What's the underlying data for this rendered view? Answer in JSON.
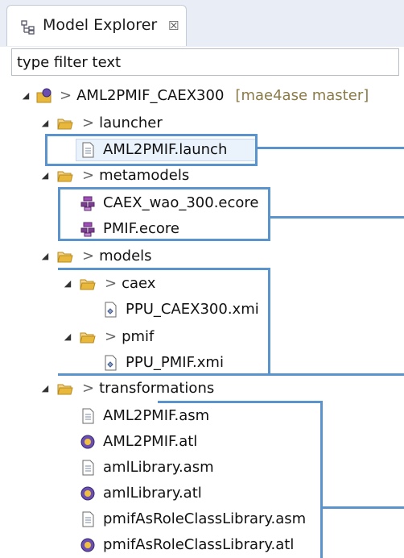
{
  "view": {
    "tab_title": "Model Explorer",
    "close_glyph": "☒",
    "tab_icon": "model-explorer-icon"
  },
  "filter": {
    "placeholder": "type filter text"
  },
  "tree": {
    "project": {
      "name": "AML2PMIF_CAEX300",
      "decoration": "[mae4ase master]",
      "prefix": ">"
    },
    "launcher": {
      "name": "launcher",
      "prefix": ">"
    },
    "launcher_file": "AML2PMIF.launch",
    "metamodels": {
      "name": "metamodels",
      "prefix": ">"
    },
    "metamodel_files": [
      "CAEX_wao_300.ecore",
      "PMIF.ecore"
    ],
    "models": {
      "name": "models",
      "prefix": ">"
    },
    "caex": {
      "name": "caex",
      "prefix": ">"
    },
    "caex_file": "PPU_CAEX300.xmi",
    "pmif": {
      "name": "pmif",
      "prefix": ">"
    },
    "pmif_file": "PPU_PMIF.xmi",
    "transformations": {
      "name": "transformations",
      "prefix": ">"
    },
    "transformation_files": [
      "AML2PMIF.asm",
      "AML2PMIF.atl",
      "amlLibrary.asm",
      "amlLibrary.atl",
      "pmifAsRoleClassLibrary.asm",
      "pmifAsRoleClassLibrary.atl"
    ]
  },
  "colors": {
    "highlight": "#5b93cc",
    "folder": "#e8b83c",
    "ecore": "#7b3f8f",
    "decoration": "#8a7a46"
  }
}
